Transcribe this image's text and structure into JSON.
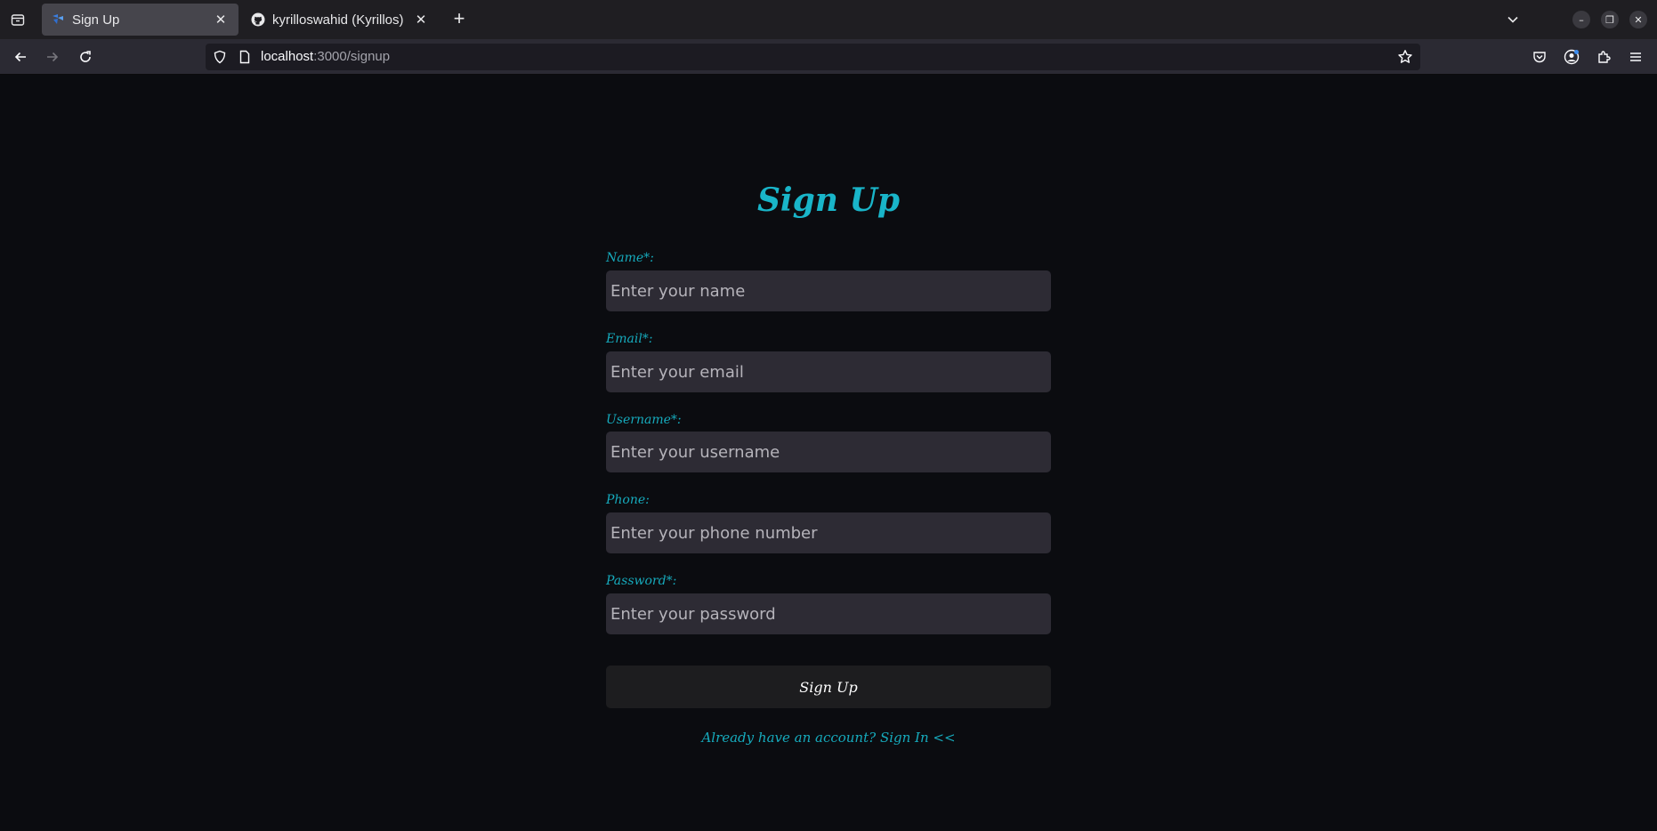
{
  "browser": {
    "tabs": [
      {
        "title": "Sign Up",
        "active": true,
        "icon": "app-favicon"
      },
      {
        "title": "kyrilloswahid (Kyrillos)",
        "active": false,
        "icon": "github-icon"
      }
    ],
    "new_tab_label": "+",
    "url": {
      "host": "localhost",
      "path": ":3000/signup"
    },
    "window_controls": {
      "minimize": "–",
      "restore": "❐",
      "close": "✕"
    }
  },
  "form": {
    "title": "Sign Up",
    "fields": [
      {
        "label": "Name*:",
        "placeholder": "Enter your name",
        "type": "text"
      },
      {
        "label": "Email*:",
        "placeholder": "Enter your email",
        "type": "email"
      },
      {
        "label": "Username*:",
        "placeholder": "Enter your username",
        "type": "text"
      },
      {
        "label": "Phone:",
        "placeholder": "Enter your phone number",
        "type": "tel"
      },
      {
        "label": "Password*:",
        "placeholder": "Enter your password",
        "type": "password"
      }
    ],
    "submit_label": "Sign Up",
    "footer": {
      "prompt": "Already have an account? ",
      "link": "Sign In <<"
    }
  },
  "colors": {
    "accent": "#19b5c9",
    "background": "#0b0c10",
    "input_bg": "#2d2b34",
    "button_bg": "#1d1d1f"
  }
}
